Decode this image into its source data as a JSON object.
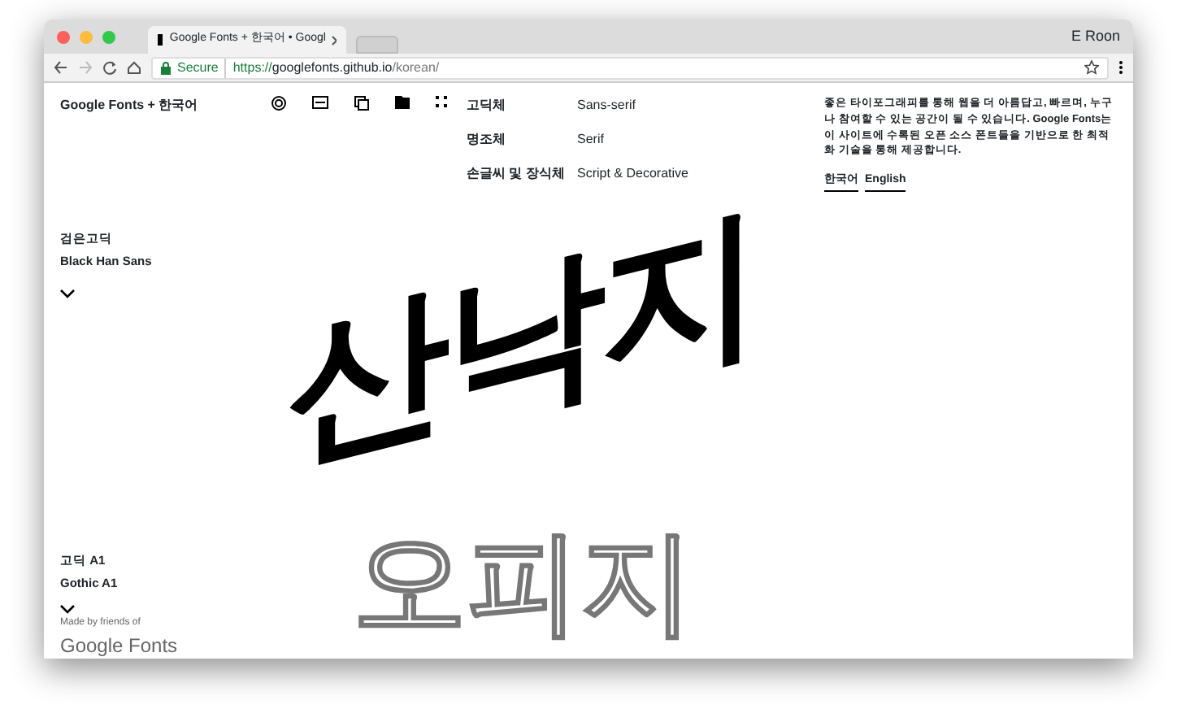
{
  "browser": {
    "tab_title": "Google Fonts + 한국어 • Googl",
    "profile": "E Roon",
    "security": "Secure",
    "url_scheme": "https://",
    "url_host": "googlefonts.github.io",
    "url_path": "/korean/"
  },
  "header": {
    "brand": "Google Fonts + 한국어",
    "categories": [
      {
        "korean": "고딕체",
        "english": "Sans-serif"
      },
      {
        "korean": "명조체",
        "english": "Serif"
      },
      {
        "korean": "손글씨 및 장식체",
        "english": "Script & Decorative"
      }
    ],
    "intro": "좋은 타이포그래피를 통해 웹을 더 아름답고, 빠르며, 누구나 참여할 수 있는 공간이 될 수 있습니다. Google Fonts는 이 사이트에 수록된 오픈 소스 폰트들을 기반으로 한 최적화 기술을 통해 제공합니다.",
    "languages": [
      "한국어",
      "English"
    ]
  },
  "featured": {
    "font_korean": "검은고딕",
    "font_english": "Black Han Sans",
    "specimen": "산낙지"
  },
  "next": {
    "font_korean": "고딕 A1",
    "font_english": "Gothic A1",
    "specimen": "오피지"
  },
  "footer": {
    "credit": "Made by friends of",
    "logo": "Google Fonts"
  }
}
